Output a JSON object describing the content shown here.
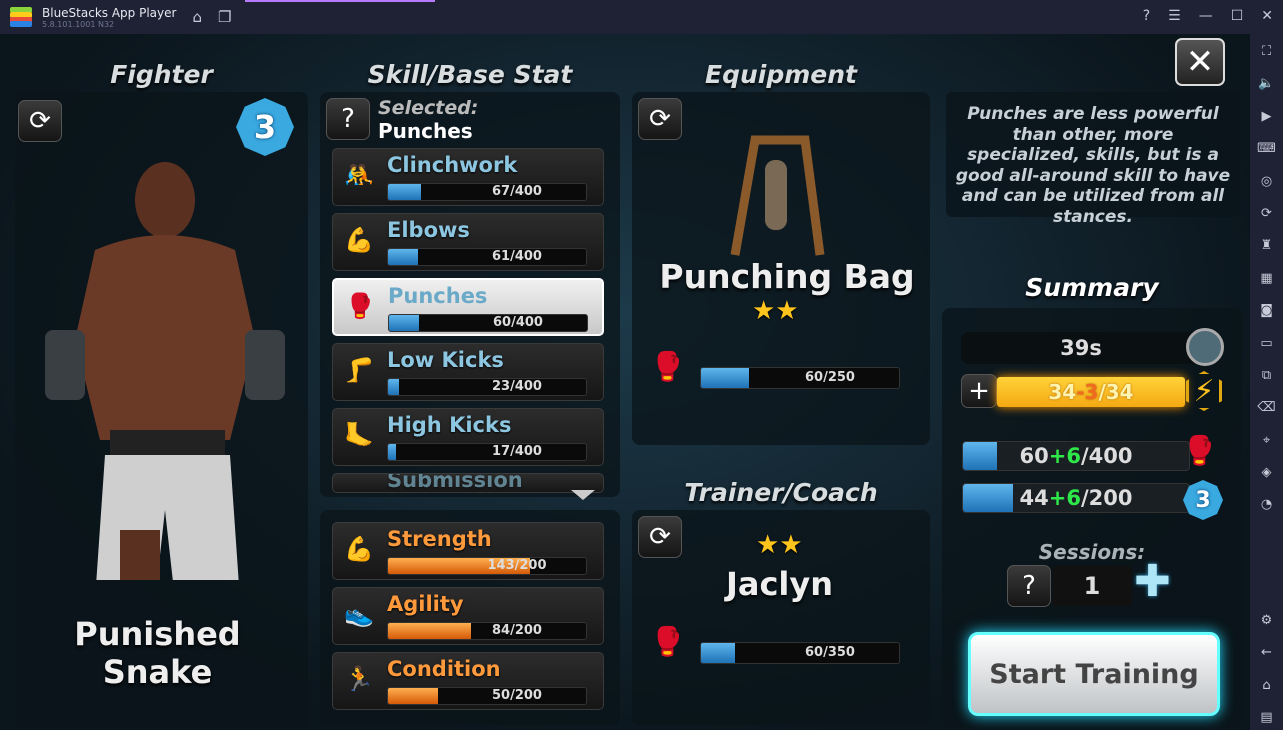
{
  "titlebar": {
    "app_name": "BlueStacks App Player",
    "version": "5.8.101.1001 N32"
  },
  "fighter": {
    "heading": "Fighter",
    "level": "3",
    "name": "Punished Snake"
  },
  "skills": {
    "heading": "Skill/Base Stat",
    "selected_label": "Selected:",
    "selected_value": "Punches",
    "items": [
      {
        "label": "Clinchwork",
        "value": 67,
        "max": 400,
        "text": "67/400",
        "icon": "clinch-icon"
      },
      {
        "label": "Elbows",
        "value": 61,
        "max": 400,
        "text": "61/400",
        "icon": "elbow-icon"
      },
      {
        "label": "Punches",
        "value": 60,
        "max": 400,
        "text": "60/400",
        "icon": "glove-icon",
        "selected": true
      },
      {
        "label": "Low Kicks",
        "value": 23,
        "max": 400,
        "text": "23/400",
        "icon": "low-kick-icon"
      },
      {
        "label": "High Kicks",
        "value": 17,
        "max": 400,
        "text": "17/400",
        "icon": "high-kick-icon"
      },
      {
        "label": "Submission",
        "partial": true
      }
    ]
  },
  "stats": [
    {
      "label": "Strength",
      "value": 143,
      "max": 200,
      "text": "143/200",
      "icon": "bicep-icon"
    },
    {
      "label": "Agility",
      "value": 84,
      "max": 200,
      "text": "84/200",
      "icon": "winged-shoe-icon"
    },
    {
      "label": "Condition",
      "value": 50,
      "max": 200,
      "text": "50/200",
      "icon": "treadmill-icon"
    }
  ],
  "equipment": {
    "heading": "Equipment",
    "name": "Punching Bag",
    "stars": 2,
    "bar_value": 60,
    "bar_max": 250,
    "bar_text": "60/250"
  },
  "trainer": {
    "heading": "Trainer/Coach",
    "name": "Jaclyn",
    "stars": 2,
    "bar_value": 60,
    "bar_max": 350,
    "bar_text": "60/350"
  },
  "description": "Punches are less powerful than other, more specialized, skills, but is a good all-around skill to have and can be utilized from all stances.",
  "summary": {
    "heading": "Summary",
    "time": "39s",
    "energy": {
      "a": "34",
      "b": "-3",
      "c": "/34"
    },
    "skill_bar": {
      "base": "60",
      "gain": "+6",
      "max": "/400",
      "value": 60,
      "total": 400
    },
    "level_bar": {
      "base": "44",
      "gain": "+6",
      "max": "/200",
      "value": 44,
      "total": 200,
      "level": "3"
    },
    "sessions_label": "Sessions:",
    "sessions": "1",
    "start_label": "Start Training"
  },
  "colors": {
    "skill_bar": "#2a8fd8",
    "stat_bar": "#f07a1a",
    "energy": "#ffc21c",
    "accent_glow": "#33ddff"
  }
}
